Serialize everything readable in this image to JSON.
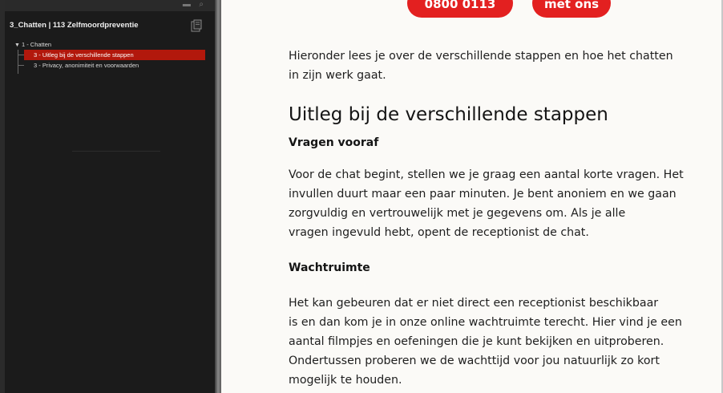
{
  "sidebar": {
    "header_title": "3_Chatten | 113 Zelfmoordpreventie",
    "tree": {
      "root_label": "1 - Chatten",
      "items": [
        {
          "label": "3 - Uitleg bij de verschillende stappen",
          "selected": true
        },
        {
          "label": "3 - Privacy, anonimiteit en voorwaarden",
          "selected": false
        }
      ]
    },
    "selected_color": "#b2180c",
    "icons": [
      "window-controls-icon",
      "note-icon",
      "tree-collapse-icon"
    ]
  },
  "content": {
    "top_buttons": [
      {
        "label": "0800 0113"
      },
      {
        "label": "met ons"
      }
    ],
    "button_color": "#e32020",
    "intro": [
      "Hieronder lees je over de verschillende stappen en hoe het chatten",
      "in zijn werk gaat."
    ],
    "heading": "Uitleg bij de verschillende stappen",
    "section1": {
      "title": "Vragen vooraf",
      "lines": [
        "Voor de chat begint, stellen we je graag een aantal korte vragen. Het",
        "invullen duurt maar een paar minuten. Je bent anoniem en we gaan",
        "zorgvuldig en vertrouwelijk met je gegevens om. Als je alle",
        "vragen ingevuld hebt, opent de receptionist de chat."
      ]
    },
    "section2": {
      "title": "Wachtruimte",
      "lines": [
        "Het kan gebeuren dat er niet direct een receptionist beschikbaar",
        "is en dan kom je in onze online wachtruimte terecht. Hier vind je een",
        "aantal filmpjes en oefeningen die je kunt bekijken en uitproberen.",
        "Ondertussen proberen we de wachttijd voor jou natuurlijk zo kort",
        "mogelijk te houden."
      ]
    }
  }
}
